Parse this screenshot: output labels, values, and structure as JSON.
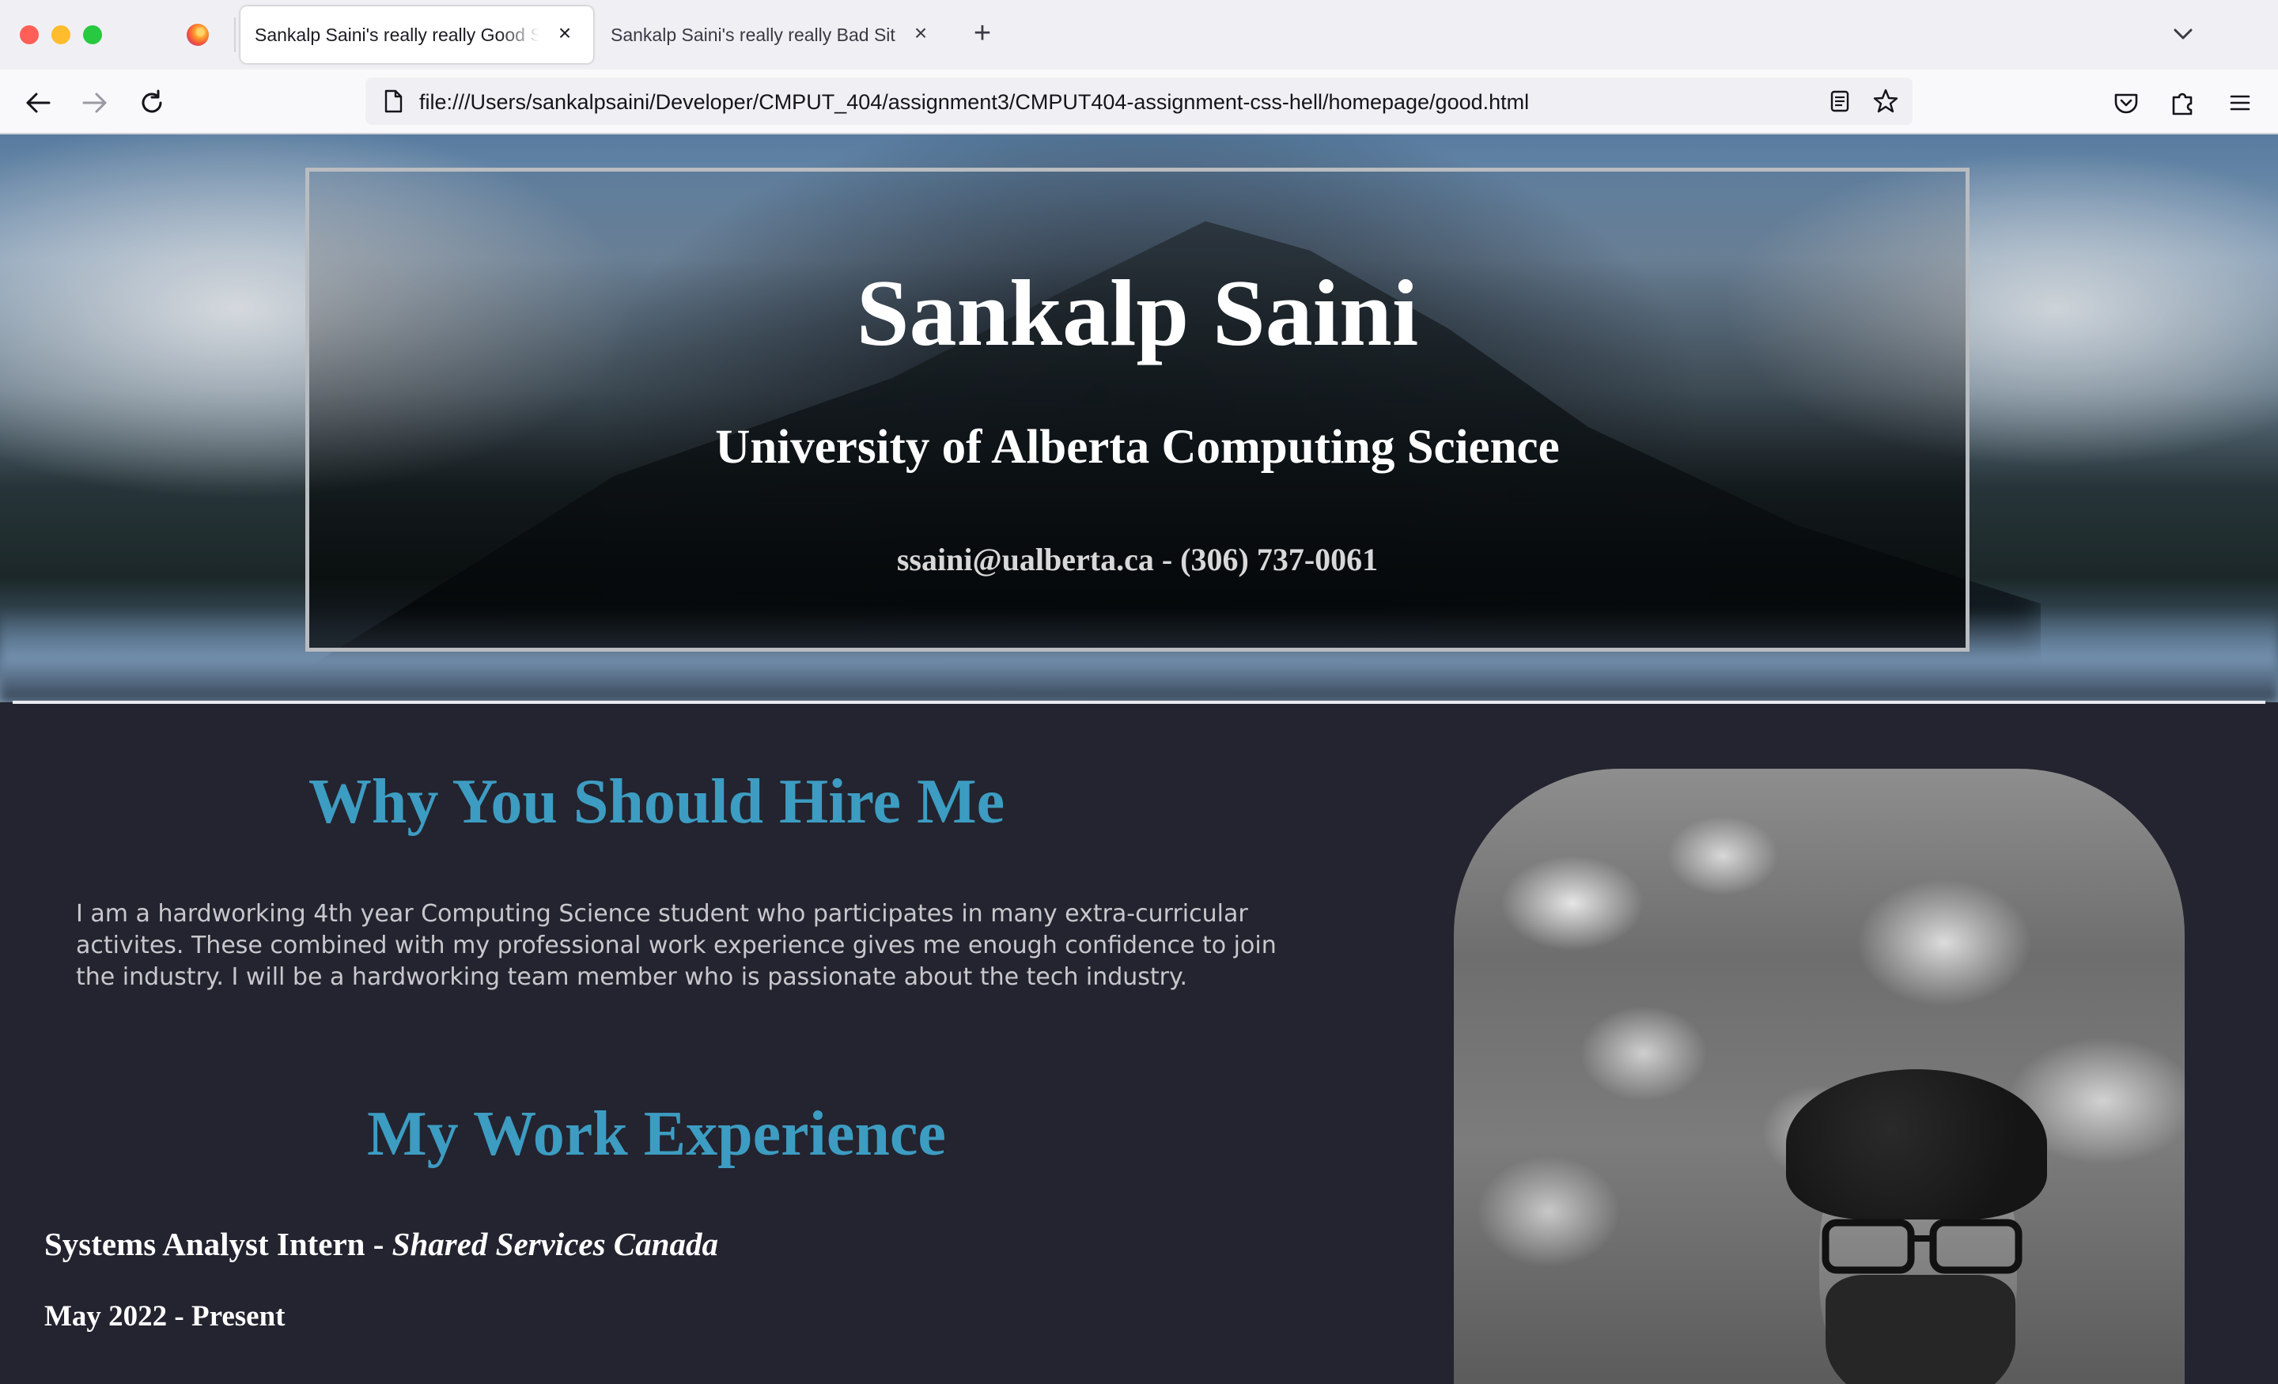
{
  "browser": {
    "tabs": [
      {
        "title": "Sankalp Saini's really really Good Site",
        "active": true
      },
      {
        "title": "Sankalp Saini's really really Bad Site",
        "active": false
      }
    ],
    "url": "file:///Users/sankalpsaini/Developer/CMPUT_404/assignment3/CMPUT404-assignment-css-hell/homepage/good.html",
    "icons": [
      "back-icon",
      "forward-icon",
      "reload-icon",
      "document-icon",
      "reader-view-icon",
      "bookmark-star-icon",
      "pocket-icon",
      "extensions-icon",
      "menu-icon",
      "new-tab-icon",
      "list-tabs-icon",
      "firefox-icon",
      "close-tab-icon"
    ]
  },
  "hero": {
    "name": "Sankalp Saini",
    "subtitle": "University of Alberta Computing Science",
    "contact": "ssaini@ualberta.ca - (306) 737-0061"
  },
  "hire": {
    "heading": "Why You Should Hire Me",
    "text": "I am a hardworking 4th year Computing Science student who participates in many extra-curricular activites. These combined with my professional work experience gives me enough confidence to join the industry. I will be a hardworking team member who is passionate about the tech industry."
  },
  "experience": {
    "heading": "My Work Experience",
    "job_role": "Systems Analyst Intern - ",
    "job_company": "Shared Services Canada",
    "job_dates": "May 2022 - Present"
  },
  "colors": {
    "page_background": "#23242f",
    "heading_accent": "#3d9cc2",
    "text": "#c8c8cc"
  }
}
